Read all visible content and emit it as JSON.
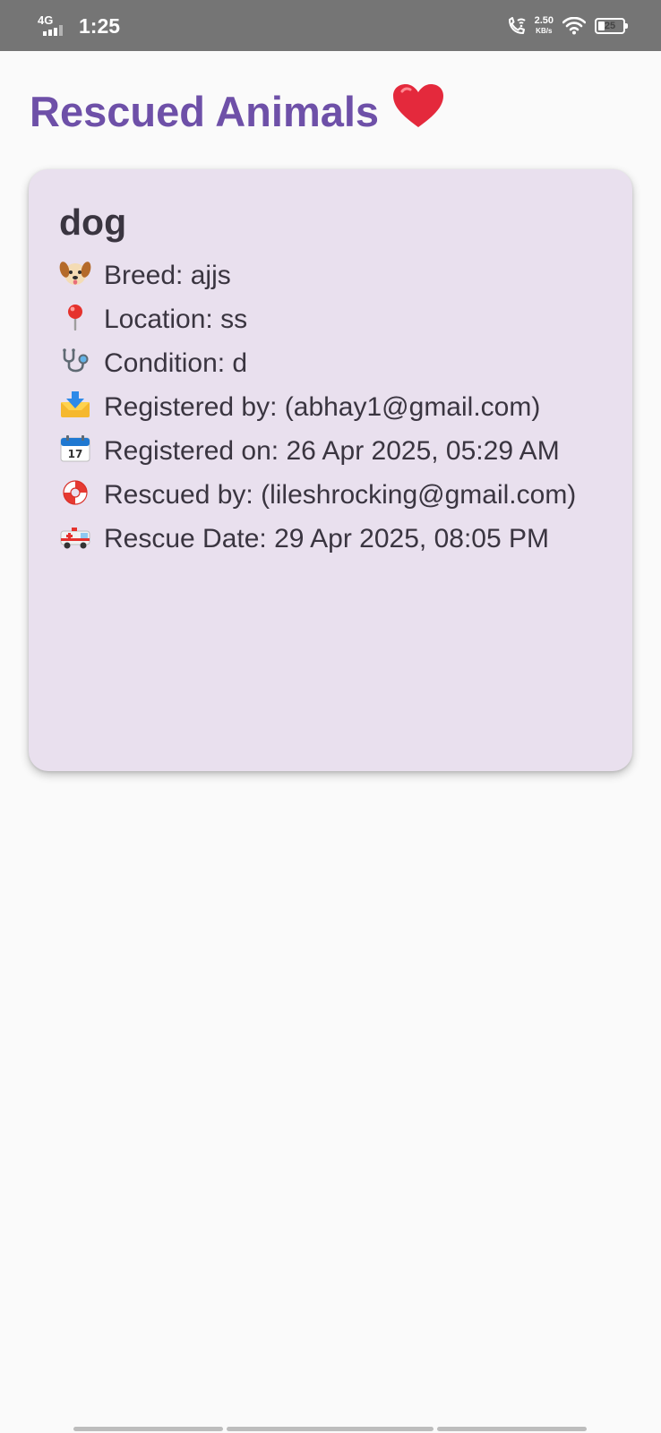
{
  "status_bar": {
    "network": "4G",
    "time": "1:25",
    "speed_value": "2.50",
    "speed_unit": "KB/s",
    "battery": "25",
    "battery_level": 0.25
  },
  "page": {
    "title": "Rescued Animals",
    "title_emoji": "heart-emoji"
  },
  "animals": [
    {
      "name": "dog",
      "breed": "🐶 Breed: ajjs",
      "location": "📍 Location: ss",
      "condition": "🩺 Condition: d",
      "registered_by": "📩 Registered by: (abhay1@gmail.com)",
      "registered_on": "📅 Registered on: 26 Apr 2025, 05:29 AM",
      "rescued_by": "🛟 Rescued by: (lileshrocking@gmail.com)",
      "rescue_date": "🚑 Rescue Date: 29 Apr 2025, 08:05 PM"
    }
  ],
  "texts": {
    "breed": "Breed: ajjs",
    "location": "Location: ss",
    "condition": "Condition: d",
    "registered_by": "Registered by: (abhay1@gmail.com)",
    "registered_on": "Registered on: 26 Apr 2025, 05:29 AM",
    "rescued_by": "Rescued by: (lileshrocking@gmail.com)",
    "rescue_date": "Rescue Date: 29 Apr 2025, 08:05 PM"
  },
  "icons": {
    "breed": "dog-face-icon",
    "location": "pin-icon",
    "condition": "stethoscope-icon",
    "registered_by": "inbox-tray-icon",
    "registered_on": "calendar-icon",
    "rescued_by": "lifebuoy-icon",
    "rescue_date": "ambulance-icon"
  },
  "colors": {
    "title": "#6e50a8",
    "card_background": "#e9e0ee",
    "status_bar": "#757575",
    "page_background": "#fafafa",
    "heart": "#e4293c"
  }
}
